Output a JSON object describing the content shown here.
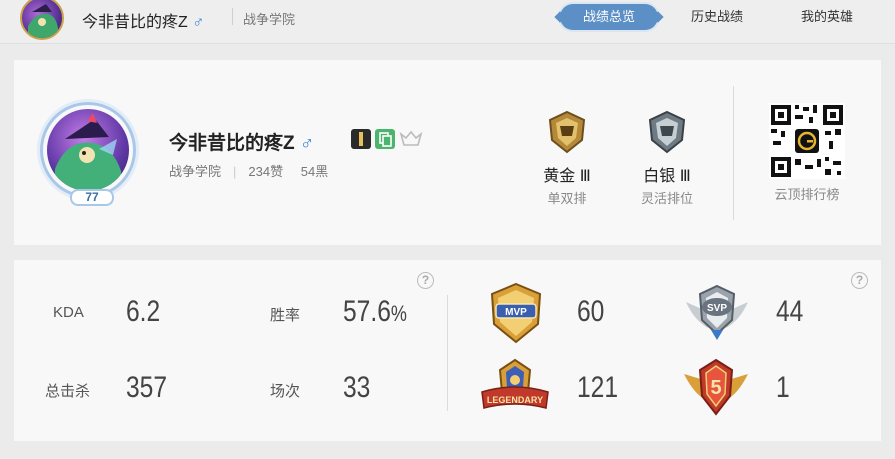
{
  "topbar": {
    "name": "今非昔比的疼Z",
    "gender_symbol": "♂",
    "server": "战争学院",
    "tabs": [
      {
        "label": "战绩总览",
        "active": true
      },
      {
        "label": "历史战绩",
        "active": false
      },
      {
        "label": "我的英雄",
        "active": false
      }
    ]
  },
  "profile": {
    "name": "今非昔比的疼Z",
    "gender_symbol": "♂",
    "level": "77",
    "server": "战争学院",
    "likes": "234赞",
    "blacks": "54黑",
    "ranks": [
      {
        "tier": "黄金 Ⅲ",
        "queue": "单双排",
        "emblem": "gold-rank-emblem"
      },
      {
        "tier": "白银 Ⅲ",
        "queue": "灵活排位",
        "emblem": "silver-rank-emblem"
      }
    ],
    "qr_label": "云顶排行榜"
  },
  "stats": {
    "help_glyph": "?",
    "kda_label": "KDA",
    "kda_value": "6.2",
    "winrate_label": "胜率",
    "winrate_value": "57.6",
    "winrate_unit": "%",
    "kills_label": "总击杀",
    "kills_value": "357",
    "games_label": "场次",
    "games_value": "33",
    "honors": [
      {
        "icon": "mvp-badge-icon",
        "text": "MVP",
        "count": "60"
      },
      {
        "icon": "svp-badge-icon",
        "text": "SVP",
        "count": "44"
      },
      {
        "icon": "legendary-badge-icon",
        "text": "LEGENDARY",
        "count": "121"
      },
      {
        "icon": "penta-kill-badge-icon",
        "text": "5",
        "count": "1"
      }
    ]
  },
  "colors": {
    "accent": "#5b8fc6",
    "male": "#2f7fd6",
    "gold": "#c9a24a"
  }
}
